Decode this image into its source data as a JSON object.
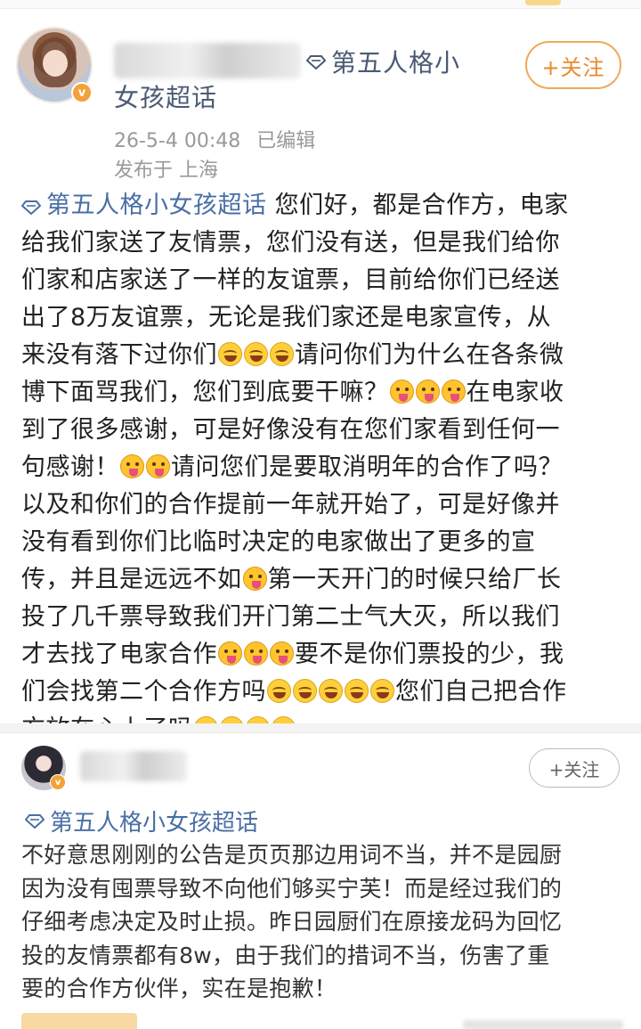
{
  "post1": {
    "supertopic_part1": "第五人格小",
    "supertopic_part2": "女孩超话",
    "follow_label": "+关注",
    "timestamp": "26-5-4 00:48",
    "edited_label": "已编辑",
    "location": "发布于 上海",
    "body": {
      "l1_tag": "第五人格小女孩超话",
      "l1_text": " 您们好，都是合作方，电家",
      "l2": "给我们家送了友情票，您们没有送，但是我们给你",
      "l3": "们家和店家送了一样的友谊票，目前给你们已经送",
      "l4": "出了8万友谊票，无论是我们家还是电家宣传，从",
      "l5a": "来没有落下过你们",
      "l5b": "请问你们为什么在各条微",
      "l6a": "博下面骂我们，您们到底要干嘛？",
      "l6b": "在电家收",
      "l7": "到了很多感谢，可是好像没有在您们家看到任何一",
      "l8a": "句感谢！",
      "l8b": "请问您们是要取消明年的合作了吗？",
      "l9": "以及和你们的合作提前一年就开始了，可是好像并",
      "l10": "没有看到你们比临时决定的电家做出了更多的宣",
      "l11a": "传，并且是远远不如",
      "l11b": "第一天开门的时候只给厂长",
      "l12": "投了几千票导致我们开门第二士气大灭，所以我们",
      "l13a": "才去找了电家合作",
      "l13b": "要不是你们票投的少，我",
      "l14a": "们会找第二个合作方吗",
      "l14b": "您们自己把合作",
      "l15": "方放在心上了吗"
    }
  },
  "post2": {
    "follow_label": "+关注",
    "supertopic": "第五人格小女孩超话",
    "body": {
      "l1": "不好意思刚刚的公告是页页那边用词不当，并不是园厨",
      "l2": "因为没有囤票导致不向他们够买宁芙！而是经过我们的",
      "l3": "仔细考虑决定及时止损。昨日园厨们在原接龙码为回忆",
      "l4": "投的友情票都有8w，由于我们的措词不当，伤害了重",
      "l5": "要的合作方伙伴，实在是抱歉！"
    }
  },
  "icons": {
    "supertopic": "diamond-icon",
    "verified": "verified-badge-icon",
    "emoji_laugh": "laugh-cry-emoji",
    "emoji_tongue": "tongue-out-emoji"
  },
  "colors": {
    "follow_accent": "#e9892e",
    "topic_link": "#4a6fa5",
    "verified_badge": "#f2a23a"
  },
  "verified_mark": "v"
}
